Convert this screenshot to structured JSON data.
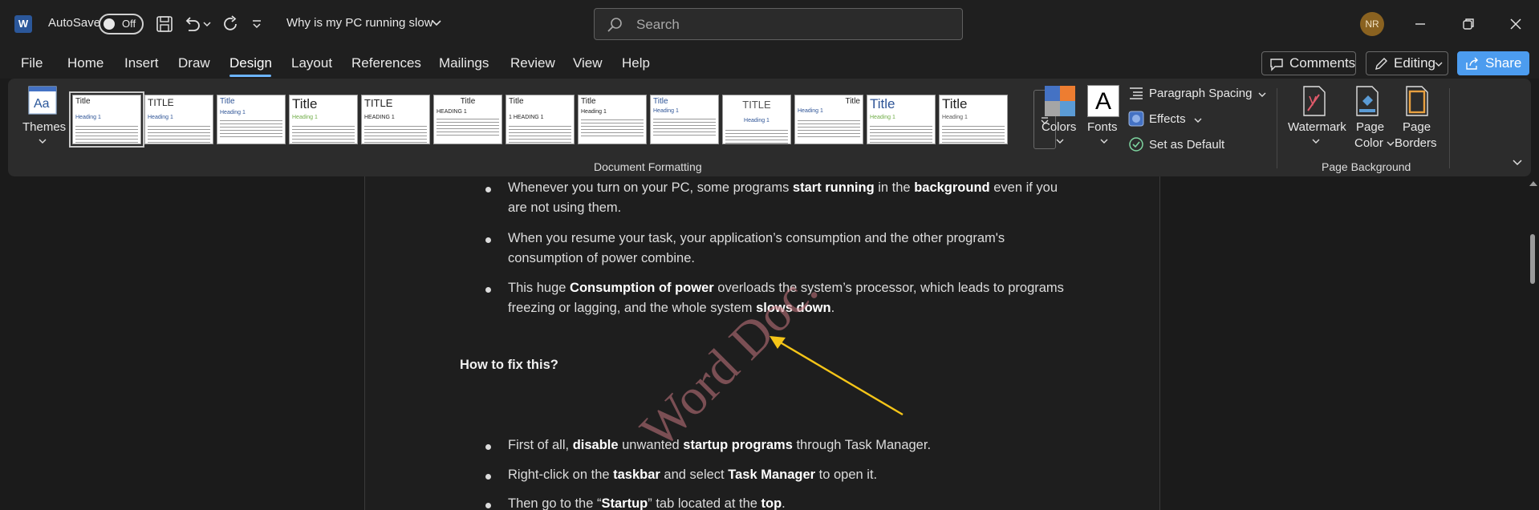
{
  "titlebar": {
    "app_logo": "W",
    "autosave_label": "AutoSave",
    "autosave_state": "Off",
    "doc_title": "Why is my PC running slow",
    "search_placeholder": "Search",
    "user_initials": "NR"
  },
  "tabs": [
    {
      "label": "File"
    },
    {
      "label": "Home"
    },
    {
      "label": "Insert"
    },
    {
      "label": "Draw"
    },
    {
      "label": "Design"
    },
    {
      "label": "Layout"
    },
    {
      "label": "References"
    },
    {
      "label": "Mailings"
    },
    {
      "label": "Review"
    },
    {
      "label": "View"
    },
    {
      "label": "Help"
    }
  ],
  "active_tab": "Design",
  "actions": {
    "comments": "Comments",
    "editing": "Editing",
    "share": "Share"
  },
  "ribbon": {
    "themes_label": "Themes",
    "document_formatting_label": "Document Formatting",
    "styles": [
      {
        "title": "Title",
        "heading": "Heading 1"
      },
      {
        "title": "TITLE",
        "heading": "Heading 1"
      },
      {
        "title": "Title",
        "heading": "Heading 1"
      },
      {
        "title": "Title",
        "heading": "Heading 1"
      },
      {
        "title": "TITLE",
        "heading": "HEADING 1"
      },
      {
        "title": "Title",
        "heading": "HEADING 1"
      },
      {
        "title": "Title",
        "heading": "1 HEADING 1"
      },
      {
        "title": "Title",
        "heading": "Heading 1"
      },
      {
        "title": "Title",
        "heading": "Heading 1"
      },
      {
        "title": "TITLE",
        "heading": "Heading 1"
      },
      {
        "title": "Title",
        "heading": "Heading 1"
      },
      {
        "title": "Title",
        "heading": "Heading 1"
      },
      {
        "title": "Title",
        "heading": "Heading 1"
      }
    ],
    "colors_label": "Colors",
    "fonts_label": "Fonts",
    "paragraph_spacing_label": "Paragraph Spacing",
    "effects_label": "Effects",
    "set_default_label": "Set as Default",
    "watermark_label": "Watermark",
    "page_color_label_1": "Page",
    "page_color_label_2": "Color",
    "page_borders_label_1": "Page",
    "page_borders_label_2": "Borders",
    "page_background_label": "Page Background"
  },
  "document": {
    "bullets_top": [
      {
        "pre": "Whenever you turn on your PC, some programs ",
        "b1": "start running",
        "mid": " in the ",
        "b2": "background",
        "post": " even if you",
        "line2": "are not using them."
      },
      {
        "line1": "When you resume your task, your application’s consumption and the other program's",
        "line2": "consumption of power combine."
      },
      {
        "pre": "This huge ",
        "b1": "Consumption of power",
        "post": " overloads the system’s processor, which leads to programs",
        "line2_pre": "freezing or lagging, and the whole system ",
        "line2_b": "slows down",
        "line2_post": "."
      }
    ],
    "heading": "How to fix this?",
    "watermark": "Word Doc.",
    "bullets_bottom": [
      {
        "pre": "First of all, ",
        "b1": "disable",
        "mid": " unwanted ",
        "b2": "startup programs",
        "post": " through Task Manager."
      },
      {
        "pre": "Right-click on the ",
        "b1": "taskbar",
        "mid": " and select ",
        "b2": "Task Manager",
        "post": " to open it."
      },
      {
        "pre": "Then go to the “",
        "b1": "Startup",
        "mid": "” tab located at the ",
        "b2": "top",
        "post": "."
      }
    ]
  },
  "colors": {
    "accent": "#6cb4ff",
    "share": "#4c9cef",
    "arrow": "#f5c518",
    "watermark": "#c87882"
  }
}
